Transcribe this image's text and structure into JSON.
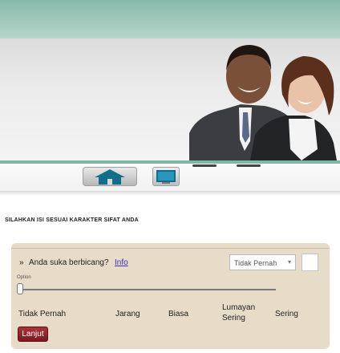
{
  "instruction": "SILAHKAN ISI SESUAI KARAKTER SIFAT ANDA",
  "question": {
    "bullet": "»",
    "text": "Anda suka berbicang?",
    "info_link": "Info",
    "selected_option": "Tidak Pernah"
  },
  "slider": {
    "label": "Option",
    "labels": [
      "Tidak Pernah",
      "Jarang",
      "Biasa",
      "Lumayan Sering",
      "Sering"
    ],
    "value_fraction": 0
  },
  "buttons": {
    "next": "Lanjut"
  },
  "icons": {
    "home": "home-icon",
    "tv": "monitor-icon",
    "select_arrow": "dropdown-arrow-icon"
  },
  "colors": {
    "band": "#86b9aa",
    "panel": "#e7dcc7",
    "next_button": "#8e2328",
    "link": "#3a2ec4"
  }
}
